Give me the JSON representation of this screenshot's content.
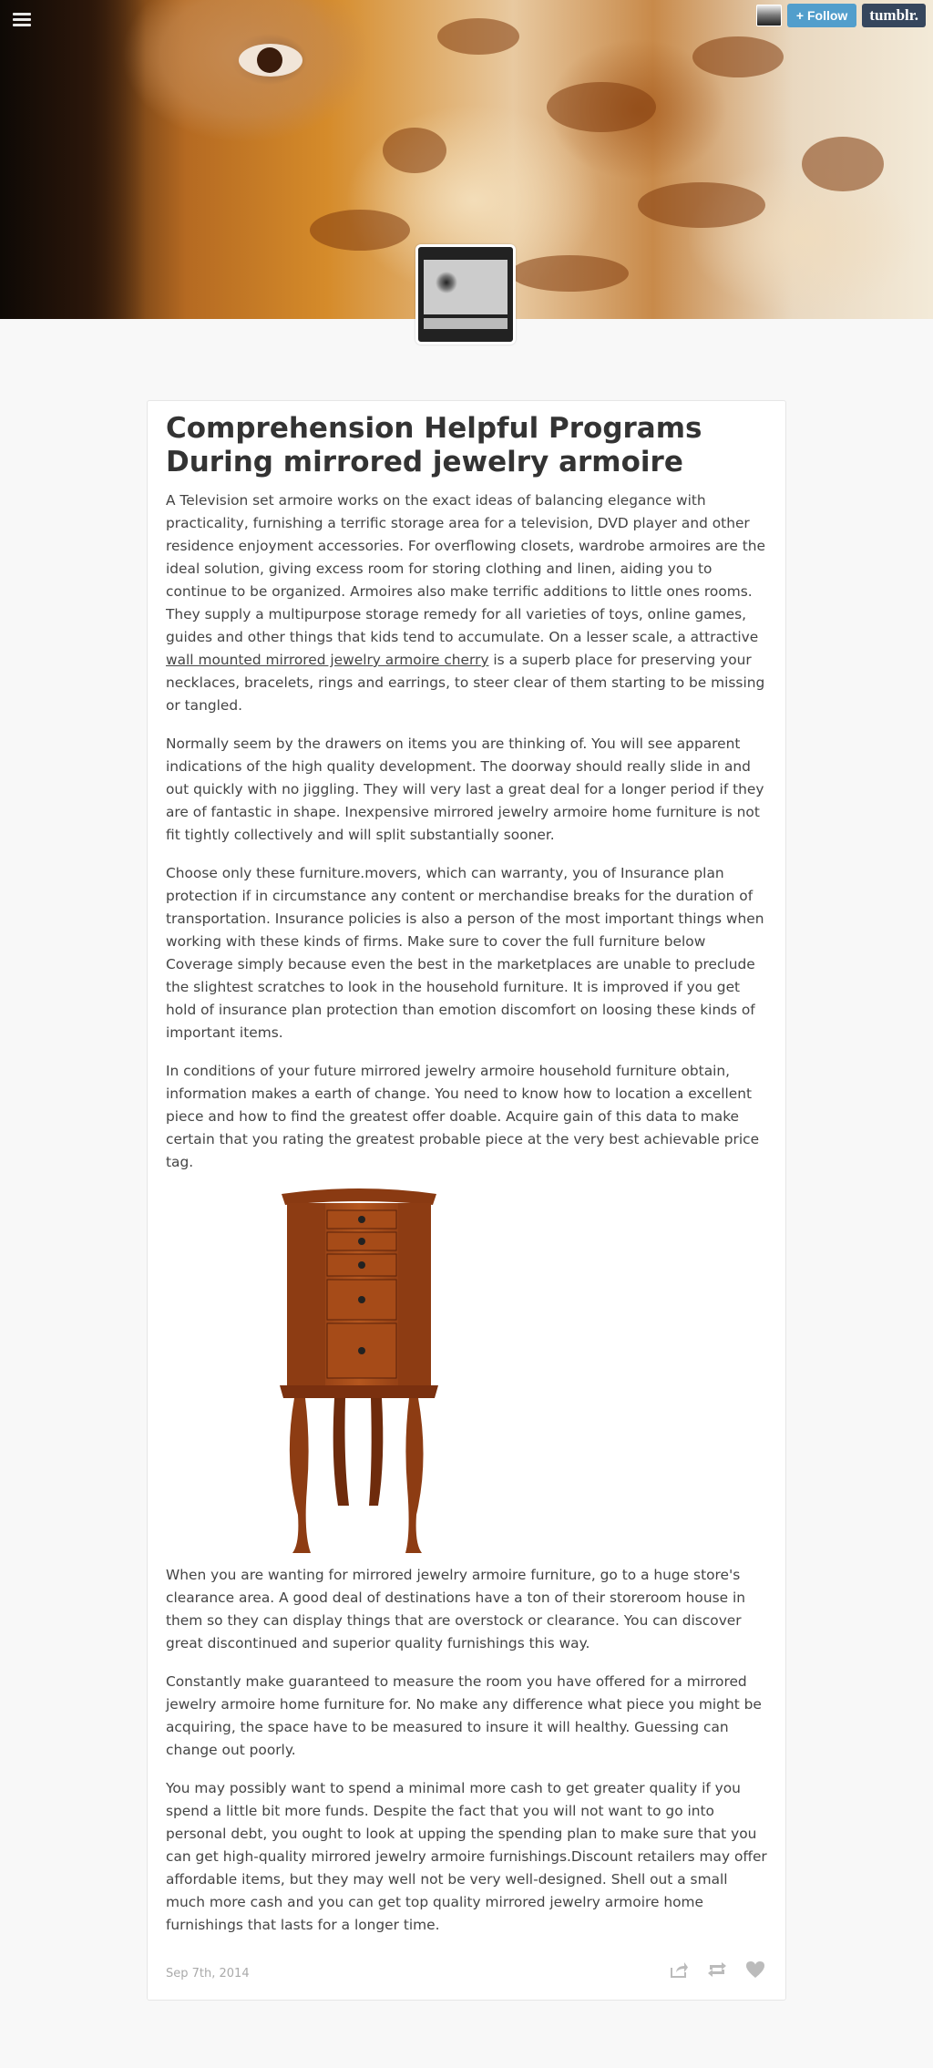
{
  "topbar": {
    "follow_label": "+ Follow",
    "logo_text": "tumblr."
  },
  "post": {
    "title": "Comprehension Helpful Programs During mirrored jewelry armoire",
    "paragraphs": [
      {
        "before": "A Television set armoire works on the exact ideas of balancing elegance with practicality, furnishing a terrific storage area for a television, DVD player and other residence enjoyment accessories. For overflowing closets, wardrobe armoires are the ideal solution, giving excess room for storing clothing and linen, aiding you to continue to be organized. Armoires also make terrific additions to little ones rooms. They supply a multipurpose storage remedy for all varieties of toys, online games, guides and other things that kids tend to accumulate. On a lesser scale, a attractive ",
        "link": "wall mounted mirrored jewelry armoire cherry",
        "after": " is a superb place for preserving your necklaces, bracelets, rings and earrings, to steer clear of them starting to be missing or tangled."
      },
      "Normally seem by the drawers on items you are thinking of. You will see apparent indications of the high quality development. The doorway should really slide in and out quickly with no jiggling. They will very last a great deal for a longer period if they are of fantastic in shape. Inexpensive mirrored jewelry armoire home furniture is not fit tightly collectively and will split substantially sooner.",
      "Choose only these furniture.movers, which can warranty, you of Insurance plan protection if in circumstance any content or merchandise breaks for the duration of transportation. Insurance policies is also a person of the most important things when working with these kinds of firms. Make sure to cover the full furniture below Coverage simply because even the best in the marketplaces are unable to preclude the slightest scratches to look in the household furniture. It is improved if you get hold of insurance plan protection than emotion discomfort on loosing these kinds of important items.",
      "In conditions of your future mirrored jewelry armoire household furniture obtain, information makes a earth of change. You need to know how to location a excellent piece and how to find the greatest offer doable. Acquire gain of this data to make certain that you rating the greatest probable piece at the very best achievable price tag.",
      "When you are wanting for mirrored jewelry armoire furniture, go to a huge store's clearance area. A good deal of destinations have a ton of their storeroom house in them so they can display things that are overstock or clearance. You can discover great discontinued and superior quality furnishings this way.",
      "Constantly make guaranteed to measure the room you have offered for a mirrored jewelry armoire home furniture for. No make any difference what piece you might be acquiring, the space have to be measured to insure it will healthy. Guessing can change out poorly.",
      "You may possibly want to spend a minimal more cash to get greater quality if you spend a little bit more funds. Despite the fact that you will not want to go into personal debt, you ought to look at upping the spending plan to make sure that you can get high-quality mirrored jewelry armoire furnishings.Discount retailers may offer affordable items, but they may well not be very well-designed. Shell out a small much more cash and you can get top quality mirrored jewelry armoire home furnishings that lasts for a longer time."
    ],
    "date": "Sep 7th, 2014",
    "actions": [
      "share-icon",
      "reblog-icon",
      "like-icon"
    ]
  }
}
